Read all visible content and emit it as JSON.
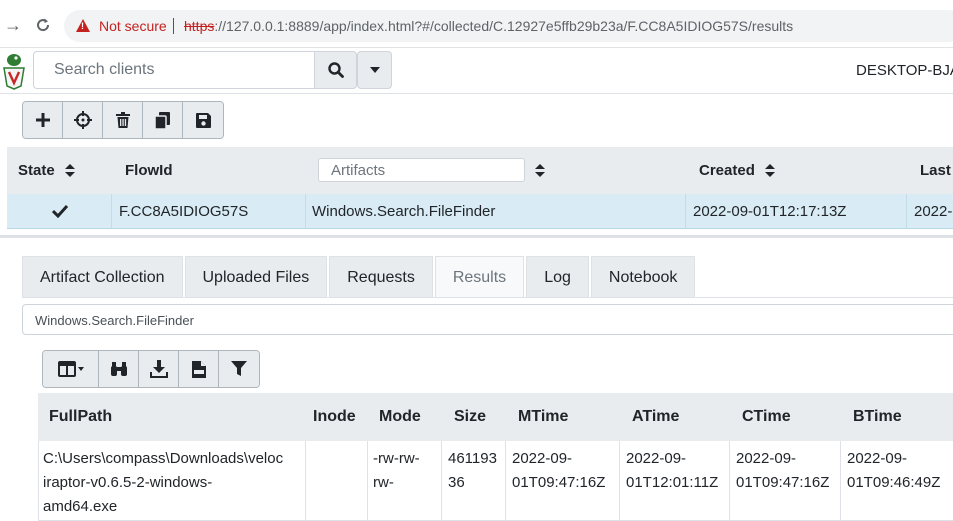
{
  "browser": {
    "security_label": "Not secure",
    "url_scheme": "https",
    "url_rest": "://127.0.0.1:8889/app/index.html?#/collected/C.12927e5ffb29b23a/F.CC8A5IDIOG57S/results"
  },
  "header": {
    "search_placeholder": "Search clients",
    "hostname": "DESKTOP-BJA"
  },
  "flows_table": {
    "columns": {
      "state": "State",
      "flow_id": "FlowId",
      "artifacts_placeholder": "Artifacts",
      "created": "Created",
      "last": "Last"
    },
    "rows": [
      {
        "flow_id": "F.CC8A5IDIOG57S",
        "artifacts": "Windows.Search.FileFinder",
        "created": "2022-09-01T12:17:13Z",
        "last": "2022-"
      }
    ]
  },
  "tabs": [
    {
      "label": "Artifact Collection"
    },
    {
      "label": "Uploaded Files"
    },
    {
      "label": "Requests"
    },
    {
      "label": "Results"
    },
    {
      "label": "Log"
    },
    {
      "label": "Notebook"
    }
  ],
  "results": {
    "artifact_selected": "Windows.Search.FileFinder",
    "columns": {
      "fullpath": "FullPath",
      "inode": "Inode",
      "mode": "Mode",
      "size": "Size",
      "mtime": "MTime",
      "atime": "ATime",
      "ctime": "CTime",
      "btime": "BTime"
    },
    "rows": [
      {
        "fullpath": "C:\\Users\\compass\\Downloads\\veloc\niraptor-v0.6.5-2-windows-\namd64.exe",
        "inode": "",
        "mode": "-rw-rw-\nrw-",
        "size": "461193\n36",
        "mtime": "2022-09-\n01T09:47:16Z",
        "atime": "2022-09-\n01T12:01:11Z",
        "ctime": "2022-09-\n01T09:47:16Z",
        "btime": "2022-09-\n01T09:46:49Z"
      }
    ]
  }
}
